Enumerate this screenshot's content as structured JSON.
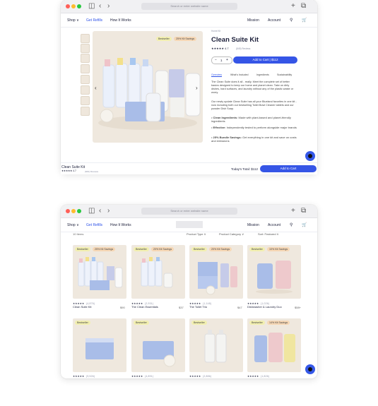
{
  "browser": {
    "url_placeholder": "Search or enter website name"
  },
  "nav": {
    "shop": "Shop ∨",
    "refills": "Get Refills",
    "how": "How It Works",
    "mission": "Mission",
    "account": "Account"
  },
  "product": {
    "breadcrumb": "Home Kit",
    "title": "Clean Suite Kit",
    "rating": "★★★★★ 4.7",
    "reviews": "(849) Reviews",
    "quantity": "1",
    "add_to_cart": "Add to Cart | $112",
    "tabs": [
      "Overview",
      "What's Included",
      "Ingredients",
      "Sustainability"
    ],
    "desc1": "The Clean Suite does it all - really. Meet the complete set of better basics designed to keep our home and planet clean. Take on dirty dishes, hard surfaces, and laundry without any of the plastic waste or worry.",
    "desc2": "Our newly update Clean Suite has all your Blueland favorites in one kit - now including both our bestselling Toilet Bowl Cleaner tablets and our powder Dish Soap.",
    "bullets": [
      {
        "title": "Clean Ingredients:",
        "text": "Made with plant-based and planet-friendly ingredients"
      },
      {
        "title": "Effective:",
        "text": "Independently tested to perform alongside major brands"
      },
      {
        "title": "25% Bundle Savings:",
        "text": "Get everything in one kit and save on costs and emissions"
      }
    ],
    "badge_bestseller": "Bestseller",
    "badge_savings": "25% Kit Savings"
  },
  "sticky": {
    "name": "Clean Suite Kit",
    "rating": "★★★★★ 4.7",
    "reviews": "(849) Reviews",
    "total": "Today's Total: $112",
    "add": "Add to Cart"
  },
  "listing": {
    "count": "10 Items",
    "filter_type": "Product Type ∨",
    "filter_category": "Product Category ∨",
    "sort": "Sort: Featured ∨",
    "row1": [
      {
        "name": "Clean Suite Kit",
        "price": "$90",
        "badge": "Bestseller",
        "savings": "25% Kit Savings",
        "reviews": "(4,876)"
      },
      {
        "name": "The Clean Essentials",
        "price": "$37",
        "badge": "Bestseller",
        "savings": "20% Kit Savings",
        "reviews": "(2,931)"
      },
      {
        "name": "The Toilet Trio",
        "price": "$47",
        "badge": "Bestseller",
        "savings": "20% Kit Savings",
        "reviews": "(1,148)"
      },
      {
        "name": "Dishwasher & Laundry Duo",
        "price": "$58+",
        "badge": "Bestseller",
        "savings": "10% Kit Savings",
        "reviews": "(1,026)"
      }
    ],
    "row2": [
      {
        "badge": "Bestseller",
        "savings": "",
        "reviews": "(9,526)"
      },
      {
        "badge": "Bestseller",
        "savings": "",
        "reviews": "(4,891)"
      },
      {
        "badge": "Bestseller",
        "savings": "",
        "reviews": "(2,886)"
      },
      {
        "badge": "Bestseller",
        "savings": "14% Kit Savings",
        "reviews": "(1,826)"
      }
    ]
  },
  "colors": {
    "accent": "#3555e6",
    "bg_product": "#efe8de"
  }
}
